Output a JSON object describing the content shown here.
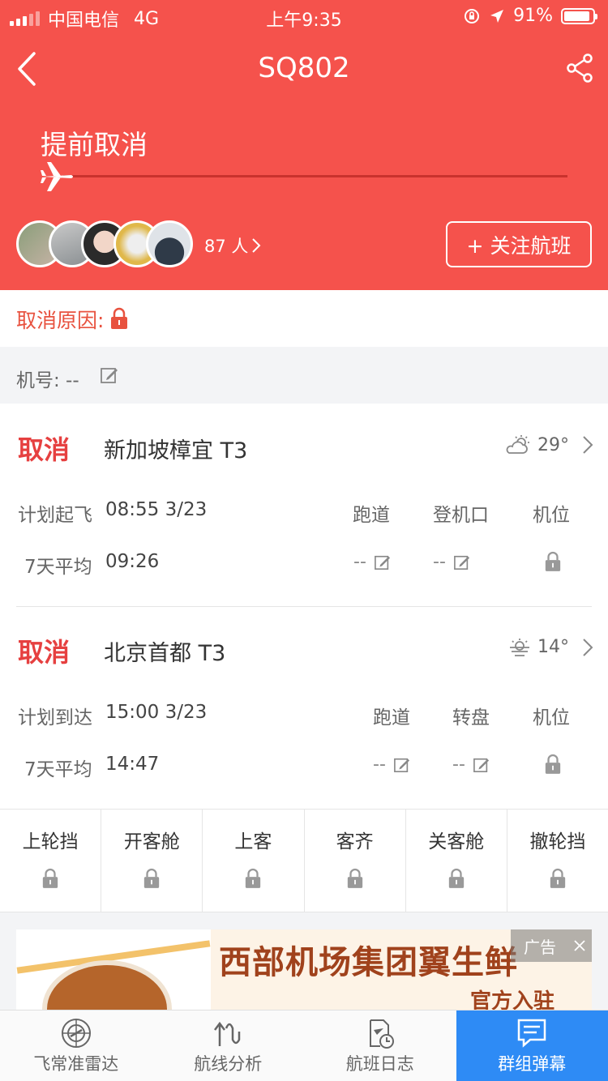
{
  "status_bar": {
    "carrier": "中国电信",
    "network": "4G",
    "time": "上午9:35",
    "battery": "91%"
  },
  "nav": {
    "title": "SQ802"
  },
  "flight_status": {
    "text": "提前取消"
  },
  "followers": {
    "count_text": "87 人"
  },
  "follow_button": {
    "label": "+ 关注航班"
  },
  "cancel_reason": {
    "label": "取消原因:"
  },
  "aircraft": {
    "label": "机号: --"
  },
  "departure": {
    "status": "取消",
    "airport": "新加坡樟宜 T3",
    "weather_temp": "29°",
    "plan_label": "计划起飞",
    "plan_time": "08:55 3/23",
    "avg_label": "7天平均",
    "avg_time": "09:26",
    "col1_head": "跑道",
    "col2_head": "登机口",
    "col3_head": "机位",
    "col1_val": "--",
    "col2_val": "--"
  },
  "arrival": {
    "status": "取消",
    "airport": "北京首都 T3",
    "weather_temp": "14°",
    "plan_label": "计划到达",
    "plan_time": "15:00 3/23",
    "avg_label": "7天平均",
    "avg_time": "14:47",
    "col1_head": "跑道",
    "col2_head": "转盘",
    "col3_head": "机位",
    "col1_val": "--",
    "col2_val": "--"
  },
  "steps": [
    "上轮挡",
    "开客舱",
    "上客",
    "客齐",
    "关客舱",
    "撤轮挡"
  ],
  "ad": {
    "title": "西部机场集团翼生鲜",
    "subtitle": "官方入驻",
    "tag": "广告"
  },
  "tabbar": {
    "tabs": [
      "飞常准雷达",
      "航线分析",
      "航班日志",
      "群组弹幕"
    ]
  },
  "colors": {
    "header_red": "#f5524c",
    "cancel_red": "#e64040",
    "active_tab_blue": "#2e8bf5"
  }
}
